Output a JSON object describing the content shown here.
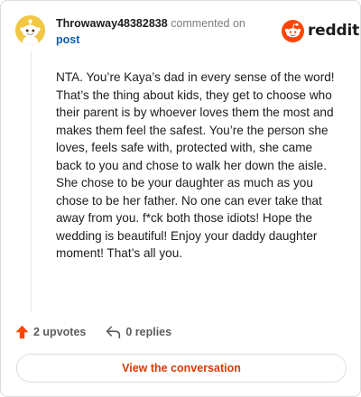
{
  "comment": {
    "author": "Throwaway48382838",
    "action_text": "commented on",
    "post_link_text": "post",
    "body": "NTA. You’re Kaya’s dad in every sense of the word! That’s the thing about kids, they get to choose who their parent is by whoever loves them the most and makes them feel the safest. You’re the person she loves, feels safe with, protected with, she came back to you and chose to walk her down the aisle. She chose to be your daughter as much as you chose to be her father. No one can ever take that away from you. f*ck both those idiots! Hope the wedding is beautiful! Enjoy your daddy daughter moment! That’s all you."
  },
  "brand": {
    "name": "reddit",
    "logo_icon": "reddit-snoo-icon",
    "accent_color": "#ff4500"
  },
  "avatar": {
    "icon": "snoo-avatar-icon",
    "background_color": "#f2c744"
  },
  "stats": {
    "upvotes_label": "2 upvotes",
    "upvote_icon": "upvote-arrow-icon",
    "upvote_color": "#ff4500",
    "replies_label": "0 replies",
    "reply_icon": "reply-arrow-icon"
  },
  "cta": {
    "label": "View the conversation",
    "color": "#d93a00"
  }
}
